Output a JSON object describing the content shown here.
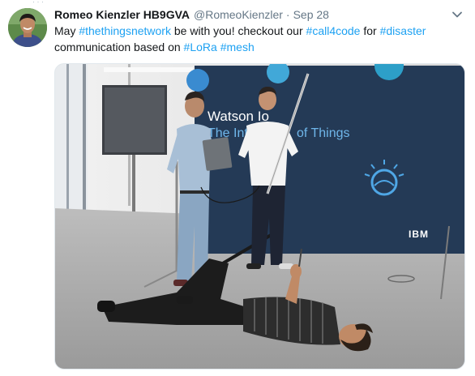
{
  "tweet": {
    "author": {
      "display_name": "Romeo Kienzler HB9GVA",
      "handle": "@RomeoKienzler",
      "avatar_icon": "user-avatar"
    },
    "separator": "·",
    "date": "Sep 28",
    "menu_icon": "chevron-down-icon",
    "text": {
      "t1": "May ",
      "tag_thethingsnetwork": "#thethingsnetwork",
      "t2": " be with you! checkout our ",
      "tag_call4code": "#call4code",
      "t3": " for ",
      "tag_disaster": "#disaster",
      "t4": "communication based on ",
      "tag_lora": "#LoRa",
      "t5": " ",
      "tag_mesh": "#mesh"
    },
    "photo": {
      "backdrop_text_line1": "Watson Io",
      "backdrop_text_line2": "The Inte",
      "backdrop_text_line3": "of Things",
      "backdrop_logo": "IBM"
    }
  },
  "colors": {
    "link": "#1da1f2",
    "secondary_text": "#657786",
    "primary_text": "#14171a",
    "backdrop": "#243a56"
  }
}
